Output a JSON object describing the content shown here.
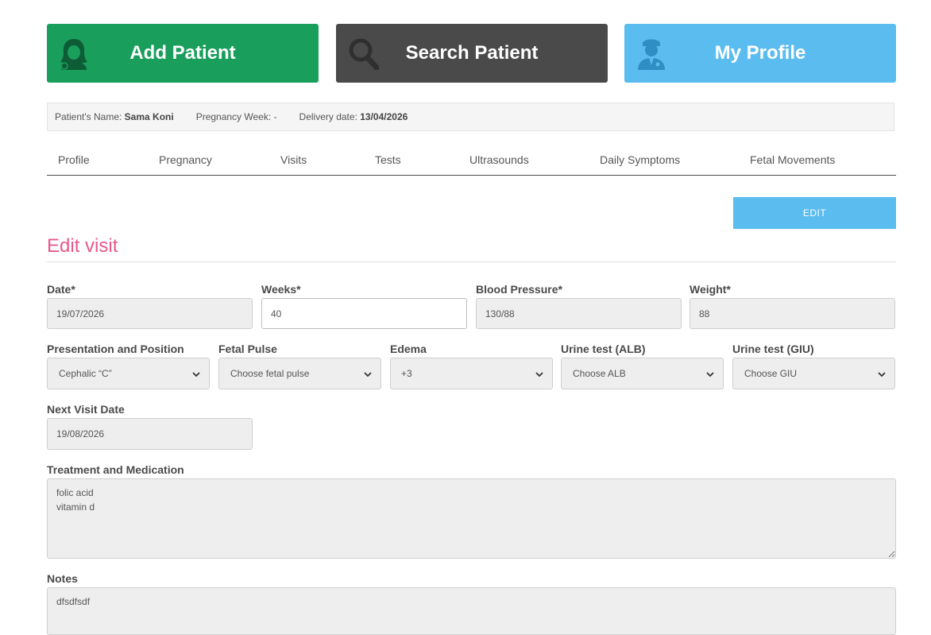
{
  "tiles": {
    "add_patient": "Add Patient",
    "search_patient": "Search Patient",
    "my_profile": "My Profile"
  },
  "info": {
    "name_label": "Patient's Name:",
    "name_value": "Sama Koni",
    "week_label": "Pregnancy Week:",
    "week_value": "-",
    "delivery_label": "Delivery date:",
    "delivery_value": "13/04/2026"
  },
  "tabs": [
    "Profile",
    "Pregnancy",
    "Visits",
    "Tests",
    "Ultrasounds",
    "Daily Symptoms",
    "Fetal Movements"
  ],
  "edit_button": "EDIT",
  "section_title": "Edit visit",
  "form": {
    "date": {
      "label": "Date*",
      "value": "19/07/2026"
    },
    "weeks": {
      "label": "Weeks*",
      "value": "40"
    },
    "blood_pressure": {
      "label": "Blood Pressure*",
      "value": "130/88"
    },
    "weight": {
      "label": "Weight*",
      "value": "88"
    },
    "presentation": {
      "label": "Presentation and Position",
      "value": "Cephalic “C”"
    },
    "fetal_pulse": {
      "label": "Fetal Pulse",
      "value": "Choose fetal pulse"
    },
    "edema": {
      "label": "Edema",
      "value": "+3"
    },
    "urine_alb": {
      "label": "Urine test (ALB)",
      "value": "Choose ALB"
    },
    "urine_giu": {
      "label": "Urine test (GIU)",
      "value": "Choose GIU"
    },
    "next_visit": {
      "label": "Next Visit Date",
      "value": "19/08/2026"
    },
    "treatment": {
      "label": "Treatment and Medication",
      "value": "folic acid\nvitamin d"
    },
    "notes": {
      "label": "Notes",
      "value": "dfsdfsdf"
    }
  },
  "colors": {
    "add": "#1a9e5c",
    "search": "#4a4a4a",
    "profile": "#5bbcef",
    "title": "#e8588c"
  },
  "icons": {
    "add": "woman-avatar-icon",
    "search": "magnifier-icon",
    "profile": "doctor-icon",
    "select": "chevron-down-icon"
  }
}
